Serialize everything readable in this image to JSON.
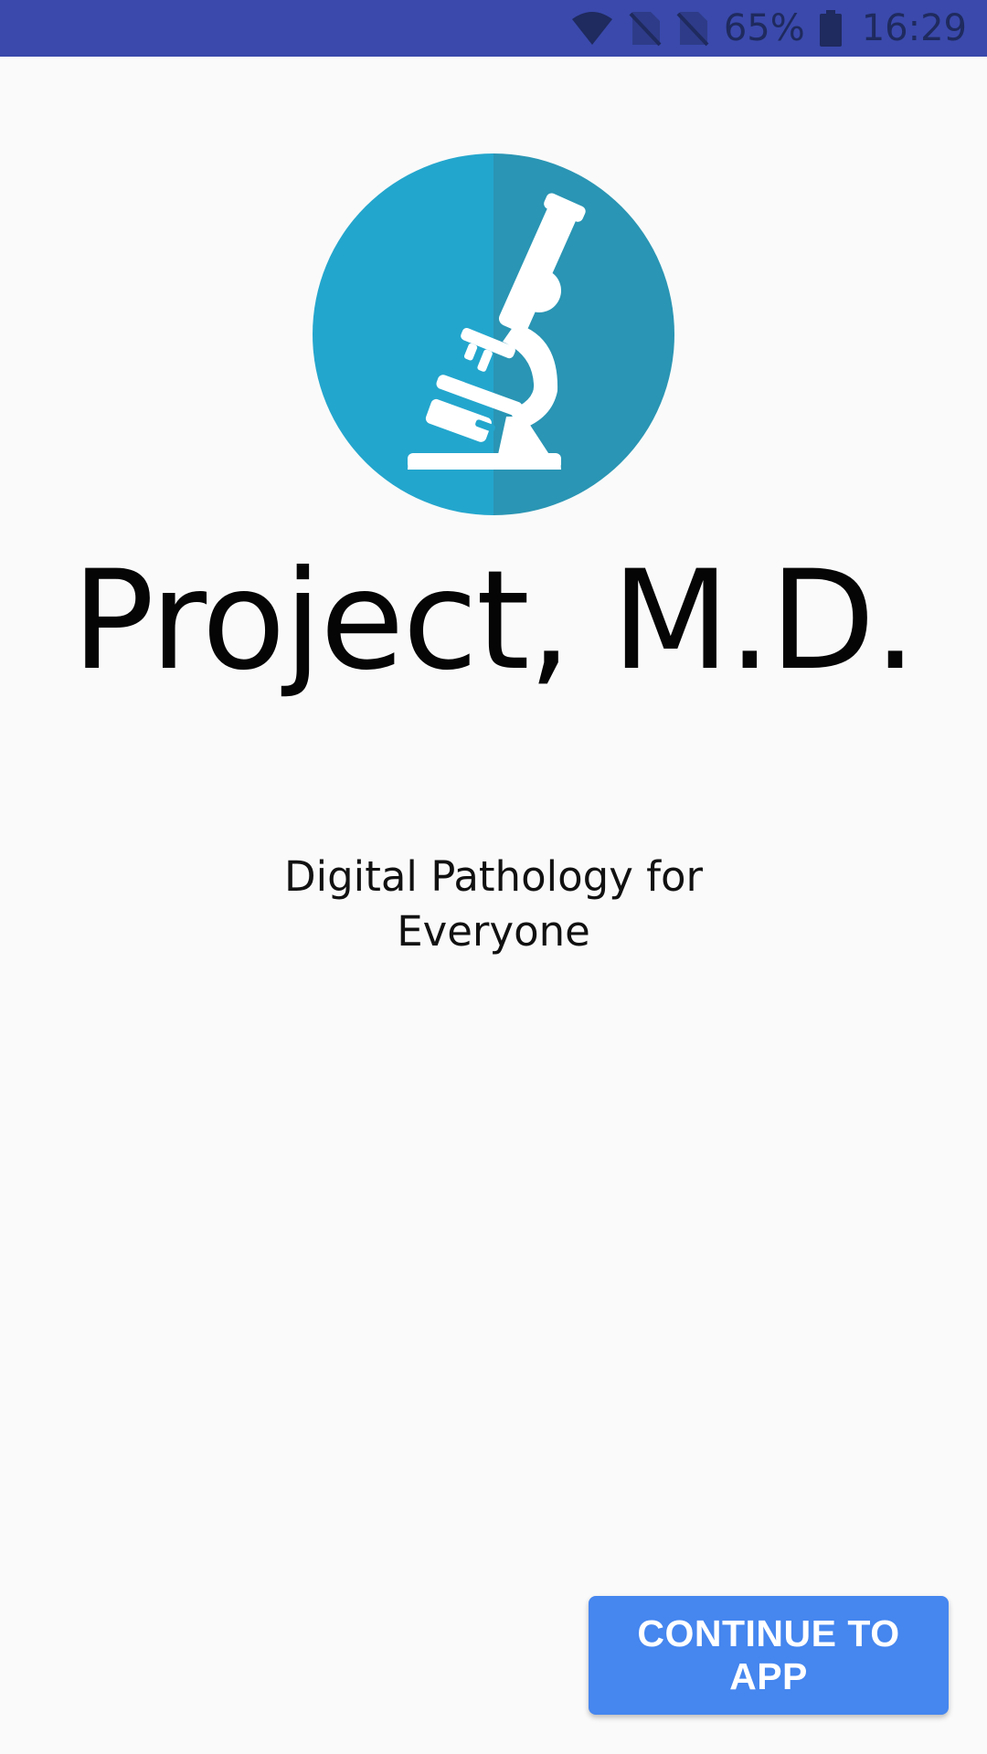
{
  "status_bar": {
    "battery_percent": "65%",
    "time": "16:29",
    "icons": [
      "wifi-icon",
      "no-sim-icon",
      "no-sim-icon",
      "battery-icon"
    ],
    "background": "#3a49ab"
  },
  "logo": {
    "icon": "microscope-icon",
    "circle_color_left": "#23a6cd",
    "circle_color_right": "#2a95b4"
  },
  "app_title": "Project, M.D.",
  "tagline": "Digital Pathology for Everyone",
  "continue_button": {
    "label": "CONTINUE TO APP",
    "color": "#4586ef"
  }
}
